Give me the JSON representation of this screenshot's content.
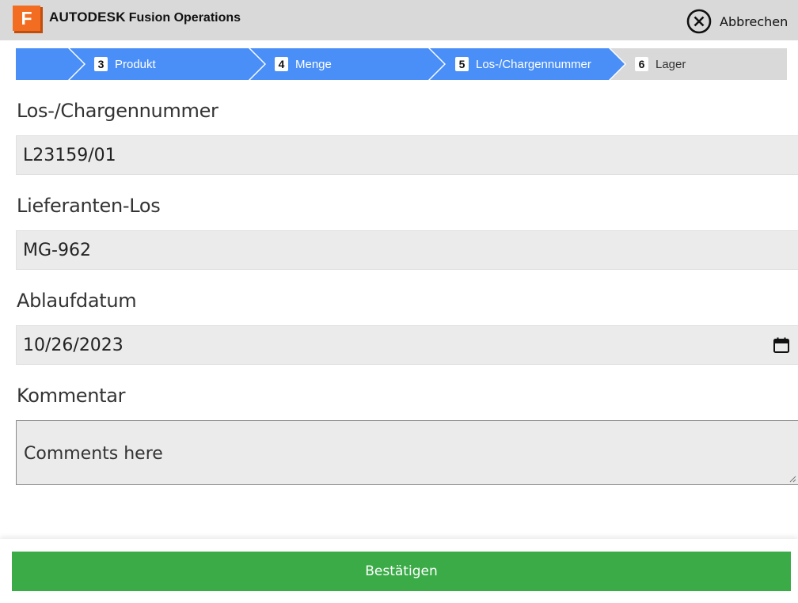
{
  "header": {
    "logo_letter": "F",
    "brand": "AUTODESK",
    "product": "Fusion Operations",
    "cancel_label": "Abbrechen"
  },
  "steps": [
    {
      "number": "",
      "label": "",
      "state": "completed"
    },
    {
      "number": "3",
      "label": "Produkt",
      "state": "completed"
    },
    {
      "number": "4",
      "label": "Menge",
      "state": "completed"
    },
    {
      "number": "5",
      "label": "Los-/Chargennummer",
      "state": "current"
    },
    {
      "number": "6",
      "label": "Lager",
      "state": "pending"
    }
  ],
  "form": {
    "lot_label": "Los-/Chargennummer",
    "lot_value": "L23159/01",
    "supplier_lot_label": "Lieferanten-Los",
    "supplier_lot_value": "MG-962",
    "expiry_label": "Ablaufdatum",
    "expiry_value": "10/26/2023",
    "comment_label": "Kommentar",
    "comment_placeholder": "Comments here"
  },
  "footer": {
    "confirm_label": "Bestätigen"
  },
  "colors": {
    "step_active": "#4a8ff7",
    "step_inactive": "#d9d9d9",
    "confirm": "#3bab48",
    "brand_orange": "#f26d21"
  }
}
